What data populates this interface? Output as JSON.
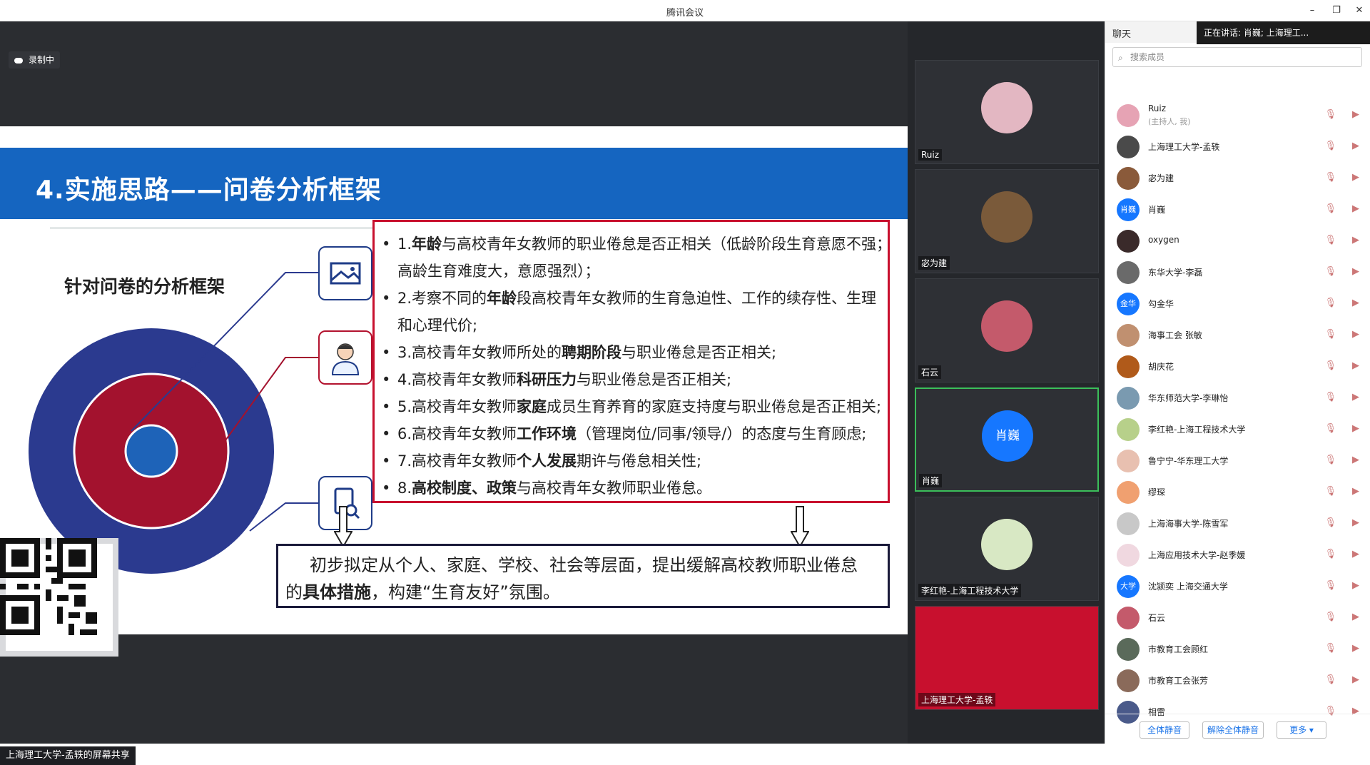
{
  "window": {
    "title": "腾讯会议",
    "minimize": "–",
    "maximize": "❐",
    "close": "✕"
  },
  "recording": {
    "label": "录制中"
  },
  "slide": {
    "title": "4.实施思路——问卷分析框架",
    "framework_title": "针对问卷的分析框架",
    "items": [
      {
        "pre": "1.",
        "bold": "年龄",
        "post": "与高校青年女教师的职业倦怠是否正相关（低龄阶段生育意愿不强；"
      },
      {
        "pre": "",
        "bold": "",
        "post": "高龄生育难度大，意愿强烈）；",
        "indent": true
      },
      {
        "pre": "2.考察不同的",
        "bold": "年龄",
        "post": "段高校青年女教师的生育急迫性、工作的续存性、生理"
      },
      {
        "pre": "",
        "bold": "",
        "post": "和心理代价;",
        "indent": true
      },
      {
        "pre": "3.高校青年女教师所处的",
        "bold": "聘期阶段",
        "post": "与职业倦怠是否正相关;"
      },
      {
        "pre": "4.高校青年女教师",
        "bold": "科研压力",
        "post": "与职业倦怠是否正相关;"
      },
      {
        "pre": "5.高校青年女教师",
        "bold": "家庭",
        "post": "成员生育养育的家庭支持度与职业倦怠是否正相关;"
      },
      {
        "pre": "6.高校青年女教师",
        "bold": "工作环境",
        "post": "（管理岗位/同事/领导/）的态度与生育顾虑;"
      },
      {
        "pre": "7.高校青年女教师",
        "bold": "个人发展",
        "post": "期许与倦怠相关性;"
      },
      {
        "pre": "8.",
        "bold": "高校制度、政策",
        "post": "与高校青年女教师职业倦怠。"
      }
    ],
    "conclusion_1": "初步拟定从个人、家庭、学校、社会等层面，提出缓解高校教师职业倦怠",
    "conclusion_2a": "的",
    "conclusion_2b": "具体措施",
    "conclusion_2c": "，构建“生育友好”氛围。",
    "colors": {
      "banner": "#1565c0",
      "outer_ring": "#2b3a8f",
      "red_ring": "#a3122e",
      "list_border": "#c8102e"
    }
  },
  "screen_share": {
    "label": "上海理工大学-孟轶的屏幕共享"
  },
  "videos": [
    {
      "name": "Ruiz",
      "color": "#e3b7c2"
    },
    {
      "name": "宓为建",
      "color": "#7a5a3a"
    },
    {
      "name": "石云",
      "color": "#c45a6b"
    },
    {
      "name": "肖巍",
      "color": "#1677ff",
      "initials": "肖巍"
    },
    {
      "name": "李红艳-上海工程技术大学",
      "color": "#d8e8c4"
    },
    {
      "name": "上海理工大学-孟轶",
      "color": "#c8102e"
    }
  ],
  "panel": {
    "tab": "聊天",
    "speaking": "正在讲话: 肖巍; 上海理工...",
    "search_placeholder": "搜索成员",
    "members": [
      {
        "name": "Ruiz",
        "sub": "(主持人, 我)",
        "color": "#e6a3b4",
        "initials": ""
      },
      {
        "name": "上海理工大学-孟轶",
        "color": "#4a4a4a",
        "initials": ""
      },
      {
        "name": "宓为建",
        "color": "#8a5a3a",
        "initials": ""
      },
      {
        "name": "肖巍",
        "color": "#1677ff",
        "initials": "肖巍"
      },
      {
        "name": "oxygen",
        "color": "#3a2a2a",
        "initials": ""
      },
      {
        "name": "东华大学-李磊",
        "color": "#6a6a6a",
        "initials": ""
      },
      {
        "name": "勾金华",
        "color": "#1677ff",
        "initials": "金华"
      },
      {
        "name": "海事工会 张敏",
        "color": "#c09070",
        "initials": ""
      },
      {
        "name": "胡庆花",
        "color": "#b05a1a",
        "initials": ""
      },
      {
        "name": "华东师范大学-李琳怡",
        "color": "#7a9ab0",
        "initials": ""
      },
      {
        "name": "李红艳-上海工程技术大学",
        "color": "#b7d08a",
        "initials": ""
      },
      {
        "name": "鲁宁宁-华东理工大学",
        "color": "#e8c0b0",
        "initials": ""
      },
      {
        "name": "缪琛",
        "color": "#f0a070",
        "initials": ""
      },
      {
        "name": "上海海事大学-陈雪军",
        "color": "#c8c8c8",
        "initials": ""
      },
      {
        "name": "上海应用技术大学-赵季媛",
        "color": "#f0d8e0",
        "initials": ""
      },
      {
        "name": "沈颍奕 上海交通大学",
        "color": "#1677ff",
        "initials": "大学"
      },
      {
        "name": "石云",
        "color": "#c45a6b",
        "initials": ""
      },
      {
        "name": "市教育工会顾红",
        "color": "#5a6a5a",
        "initials": ""
      },
      {
        "name": "市教育工会张芳",
        "color": "#8a6a5a",
        "initials": ""
      },
      {
        "name": "相雷",
        "color": "#4a5a8a",
        "initials": ""
      }
    ],
    "buttons": {
      "mute_all": "全体静音",
      "unmute_all": "解除全体静音",
      "more": "更多 ▾"
    }
  }
}
